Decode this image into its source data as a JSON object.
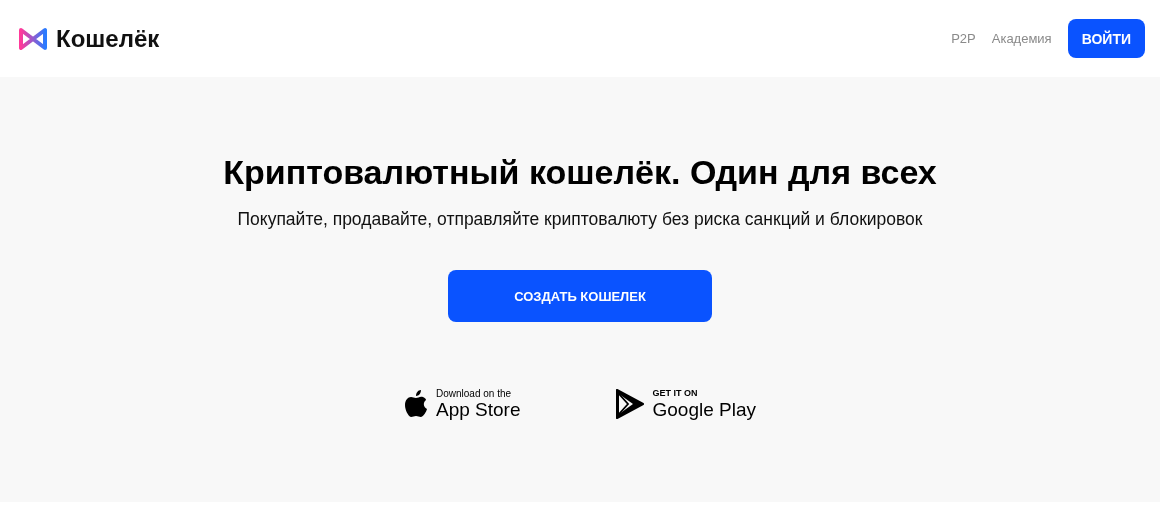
{
  "header": {
    "logo": "Кошелёк",
    "nav": [
      {
        "label": "P2P"
      },
      {
        "label": "Академия"
      }
    ],
    "login_button": "ВОЙТИ"
  },
  "hero": {
    "title": "Криптовалютный кошелёк. Один для всех",
    "subtitle": "Покупайте, продавайте, отправляйте криптовалюту без риска санкций и блокировок",
    "cta": "СОЗДАТЬ КОШЕЛЕК"
  },
  "stores": [
    {
      "kind": "apple",
      "small": "Download on the",
      "big": "App Store"
    },
    {
      "kind": "google",
      "small": "GET IT ON",
      "big": "Google Play"
    }
  ]
}
